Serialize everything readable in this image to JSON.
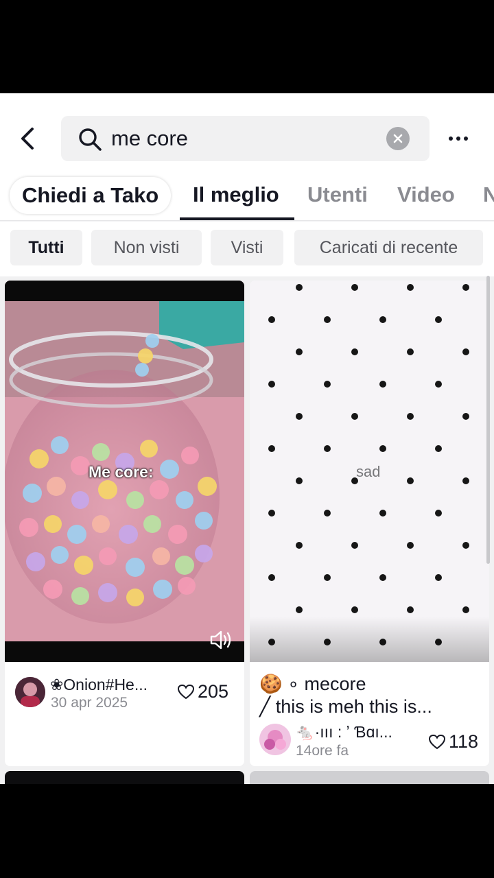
{
  "search": {
    "query": "me core"
  },
  "tabs": [
    {
      "label": "Chiedi a Tako"
    },
    {
      "label": "Il meglio"
    },
    {
      "label": "Utenti"
    },
    {
      "label": "Video"
    },
    {
      "label": "N"
    }
  ],
  "filters": [
    {
      "label": "Tutti"
    },
    {
      "label": "Non visti"
    },
    {
      "label": "Visti"
    },
    {
      "label": "Caricati di recente"
    }
  ],
  "videos": [
    {
      "overlay_text": "Me core:",
      "author": "❀Onion#He...",
      "date": "30 apr 2025",
      "likes": "205"
    },
    {
      "overlay_text": "sad",
      "desc_line1": "🍪       ∘                 mecore",
      "desc_line2": "╱  this is meh this is...",
      "author": "🐁·ııı :  ʼ  Ɓɑı...",
      "date": "14ore fa",
      "likes": "118"
    }
  ],
  "colors": {
    "text": "#161823",
    "muted": "#8a8b91",
    "chip_bg": "#f1f1f2"
  }
}
